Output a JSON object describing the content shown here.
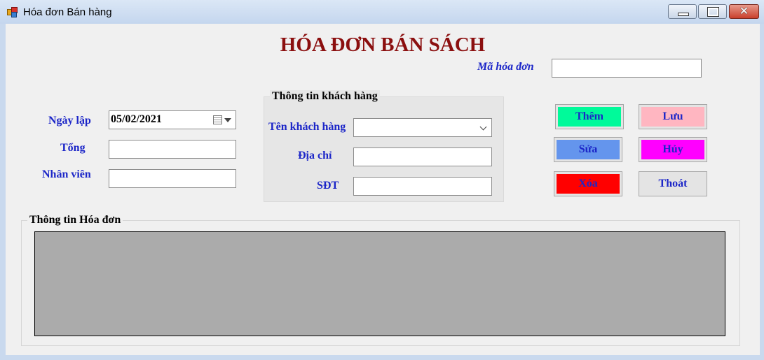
{
  "window": {
    "title": "Hóa đơn Bán hàng",
    "controls": {
      "minimize": "minimize",
      "maximize": "maximize",
      "close": "✕"
    }
  },
  "form": {
    "heading": "HÓA ĐƠN BÁN SÁCH",
    "invoice_id_label": "Mã hóa đơn",
    "invoice_id_value": "",
    "date_label": "Ngày lập",
    "date_value": "05/02/2021",
    "total_label": "Tổng",
    "total_value": "",
    "staff_label": "Nhân viên",
    "staff_value": ""
  },
  "customer_group": {
    "title": "Thông tin khách hàng",
    "name_label": "Tên khách hàng",
    "name_value": "",
    "address_label": "Địa chỉ",
    "address_value": "",
    "phone_label": "SĐT",
    "phone_value": ""
  },
  "buttons": {
    "add": "Thêm",
    "save": "Lưu",
    "edit": "Sửa",
    "cancel": "Hủy",
    "delete": "Xóa",
    "exit": "Thoát"
  },
  "button_colors": {
    "add": "#00fa9a",
    "save": "#ffb6c1",
    "edit": "#6495ed",
    "cancel": "#ff00ff",
    "delete": "#ff0000",
    "exit": "#e4e4e4"
  },
  "invoice_group": {
    "title": "Thông tin Hóa đơn"
  },
  "icons": [
    "app-icon",
    "calendar-icon",
    "dropdown-arrow-icon",
    "chevron-down-icon"
  ]
}
